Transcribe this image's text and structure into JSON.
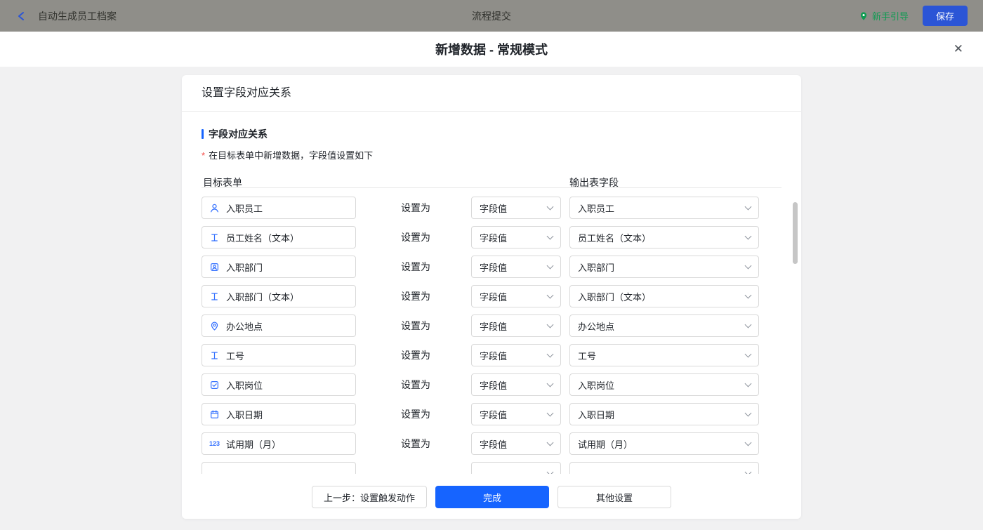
{
  "topbar": {
    "back_label": "自动生成员工档案",
    "center_title": "流程提交",
    "guide_label": "新手引导",
    "save_label": "保存"
  },
  "modal": {
    "title": "新增数据 - 常规模式",
    "close_glyph": "✕"
  },
  "card": {
    "header": "设置字段对应关系",
    "section_title": "字段对应关系",
    "note_asterisk": "*",
    "section_note": "在目标表单中新增数据，字段值设置如下",
    "col_left": "目标表单",
    "col_right": "输出表字段",
    "rows": [
      {
        "icon": "person-icon",
        "field": "入职员工",
        "set": "设置为",
        "value": "字段值",
        "output": "入职员工"
      },
      {
        "icon": "text-field-icon",
        "field": "员工姓名（文本）",
        "set": "设置为",
        "value": "字段值",
        "output": "员工姓名（文本）"
      },
      {
        "icon": "department-icon",
        "field": "入职部门",
        "set": "设置为",
        "value": "字段值",
        "output": "入职部门"
      },
      {
        "icon": "text-field-icon",
        "field": "入职部门（文本）",
        "set": "设置为",
        "value": "字段值",
        "output": "入职部门（文本）"
      },
      {
        "icon": "location-icon",
        "field": "办公地点",
        "set": "设置为",
        "value": "字段值",
        "output": "办公地点"
      },
      {
        "icon": "text-field-icon",
        "field": "工号",
        "set": "设置为",
        "value": "字段值",
        "output": "工号"
      },
      {
        "icon": "select-icon",
        "field": "入职岗位",
        "set": "设置为",
        "value": "字段值",
        "output": "入职岗位"
      },
      {
        "icon": "calendar-icon",
        "field": "入职日期",
        "set": "设置为",
        "value": "字段值",
        "output": "入职日期"
      },
      {
        "icon": "number-icon",
        "field": "试用期（月）",
        "set": "设置为",
        "value": "字段值",
        "output": "试用期（月）"
      },
      {
        "icon": "",
        "field": "",
        "set": "",
        "value": "",
        "output": ""
      }
    ]
  },
  "footer": {
    "prev_label": "上一步：设置触发动作",
    "done_label": "完成",
    "other_label": "其他设置"
  },
  "colors": {
    "accent_blue": "#1664ff",
    "save_button_blue": "#2b55d6",
    "guide_green": "#0f9b52",
    "asterisk_red": "#f54a45",
    "topbar_bg": "#8f8e89",
    "page_bg": "#f1f1f2",
    "border": "#d9d9d9",
    "field_icon_blue": "#3370ff"
  }
}
